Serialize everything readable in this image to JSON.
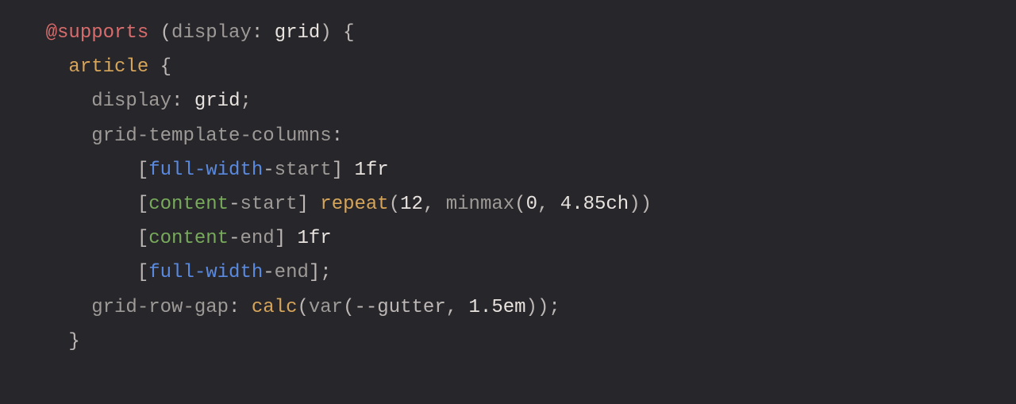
{
  "code": {
    "atrule": "@supports",
    "condition_prop": "display",
    "condition_val": "grid",
    "open_brace": "{",
    "close_brace": "}",
    "selector": "article",
    "display_prop": "display",
    "display_val": "grid",
    "gtc_prop": "grid-template-columns",
    "lines": {
      "l1_bracket_open": "[",
      "l1_name1": "full-width",
      "l1_dash": "-",
      "l1_name2": "start",
      "l1_bracket_close": "]",
      "l1_size": "1fr",
      "l2_bracket_open": "[",
      "l2_name1": "content",
      "l2_dash": "-",
      "l2_name2": "start",
      "l2_bracket_close": "]",
      "l2_func": "repeat",
      "l2_args_a": "12",
      "l2_args_minmax": "minmax",
      "l2_args_m0": "0",
      "l2_args_m1": "4.85ch",
      "l3_bracket_open": "[",
      "l3_name1": "content",
      "l3_dash": "-",
      "l3_name2": "end",
      "l3_bracket_close": "]",
      "l3_size": "1fr",
      "l4_bracket_open": "[",
      "l4_name1": "full-width",
      "l4_dash": "-",
      "l4_name2": "end",
      "l4_bracket_close": "]"
    },
    "grg_prop": "grid-row-gap",
    "grg_func": "calc",
    "grg_var": "var",
    "grg_varname": "--gutter",
    "grg_fallback": "1.5em",
    "colon": ":",
    "semicolon": ";",
    "comma": ",",
    "paren_open": "(",
    "paren_close": ")"
  }
}
